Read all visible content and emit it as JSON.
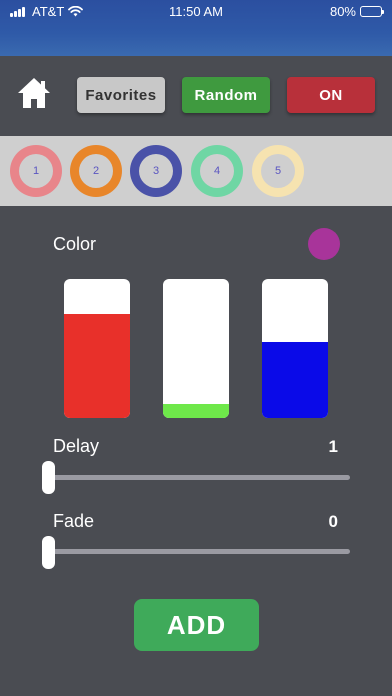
{
  "status_bar": {
    "carrier": "AT&T",
    "time": "11:50 AM",
    "battery": "80%",
    "battery_level": 0.8
  },
  "toolbar": {
    "favorites_label": "Favorites",
    "random_label": "Random",
    "on_label": "ON",
    "colors": {
      "favorites": "#c8c8c8",
      "random": "#3f9a3f",
      "on": "#b8303a"
    }
  },
  "presets": [
    {
      "label": "1",
      "ring_color": "#e8858a"
    },
    {
      "label": "2",
      "ring_color": "#e8862a"
    },
    {
      "label": "3",
      "ring_color": "#4a52a8"
    },
    {
      "label": "4",
      "ring_color": "#6fd6a4"
    },
    {
      "label": "5",
      "ring_color": "#f6e3b0"
    }
  ],
  "color": {
    "label": "Color",
    "current": "#a8349a",
    "channels": [
      {
        "name": "red",
        "color": "#e8302a",
        "level": 0.75
      },
      {
        "name": "green",
        "color": "#6ee84a",
        "level": 0.1
      },
      {
        "name": "blue",
        "color": "#0a0ae8",
        "level": 0.55
      }
    ]
  },
  "delay": {
    "label": "Delay",
    "value": "1",
    "position": 0.0
  },
  "fade": {
    "label": "Fade",
    "value": "0",
    "position": 0.0
  },
  "add_label": "ADD"
}
